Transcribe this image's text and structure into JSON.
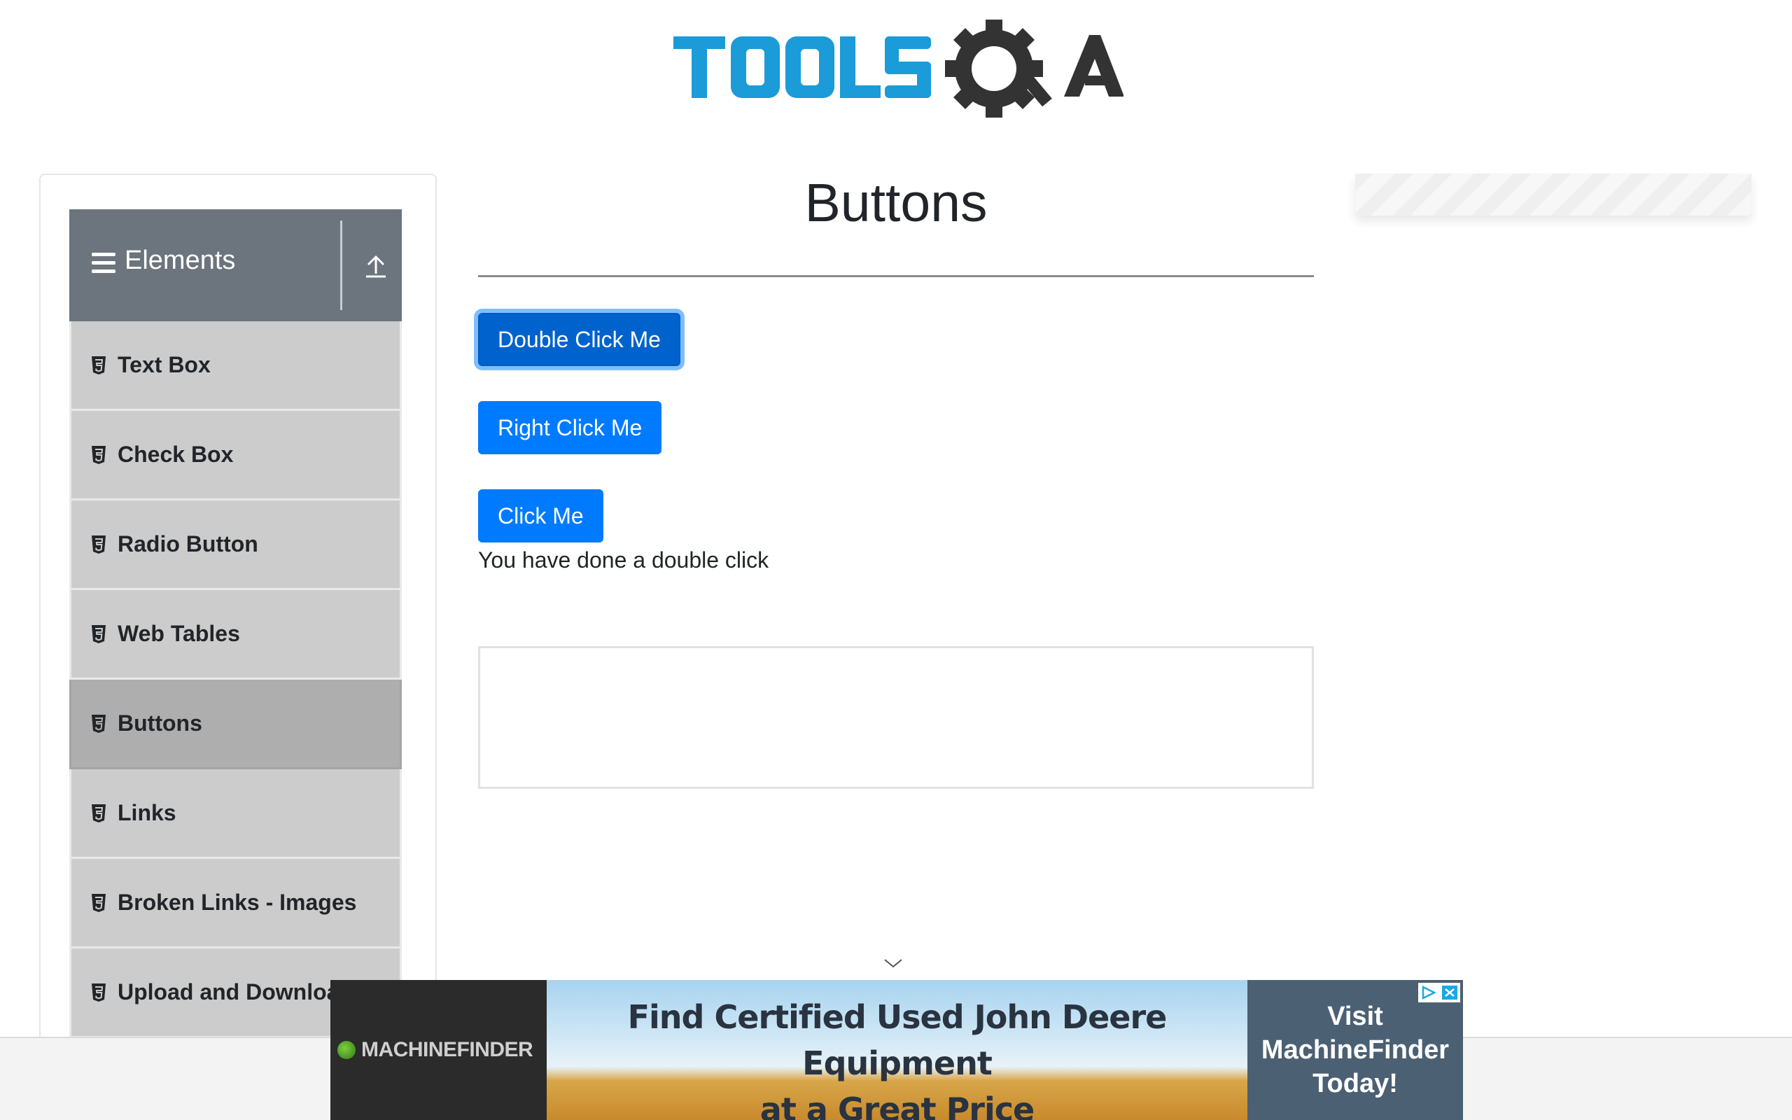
{
  "header": {
    "logo_text": "TOOLSQA"
  },
  "sidebar": {
    "group_title": "Elements",
    "items": [
      {
        "label": "Text Box",
        "active": false
      },
      {
        "label": "Check Box",
        "active": false
      },
      {
        "label": "Radio Button",
        "active": false
      },
      {
        "label": "Web Tables",
        "active": false
      },
      {
        "label": "Buttons",
        "active": true
      },
      {
        "label": "Links",
        "active": false
      },
      {
        "label": "Broken Links - Images",
        "active": false
      },
      {
        "label": "Upload and Download",
        "active": false
      }
    ]
  },
  "main": {
    "title": "Buttons",
    "double_click_button": "Double Click Me",
    "right_click_button": "Right Click Me",
    "click_button": "Click Me",
    "result_message": "You have done a double click"
  },
  "ad": {
    "brand": "MACHINEFINDER",
    "headline_line1": "Find Certified Used John Deere Equipment",
    "headline_line2": "at a Great Price",
    "cta_line1": "Visit",
    "cta_line2": "MachineFinder",
    "cta_line3": "Today!"
  },
  "colors": {
    "primary": "#007bff",
    "sidebar_header": "#6c757d",
    "menu_item": "#cccccc",
    "menu_item_active": "#aeaeae",
    "logo_blue": "#1b9bd7"
  },
  "icons": {
    "menu": "hamburger-icon",
    "collapse": "collapse-up-icon",
    "menu_item": "html5-doc-icon",
    "ad_expand": "chevron-down-icon",
    "ad_choices": "adchoices-icon"
  }
}
